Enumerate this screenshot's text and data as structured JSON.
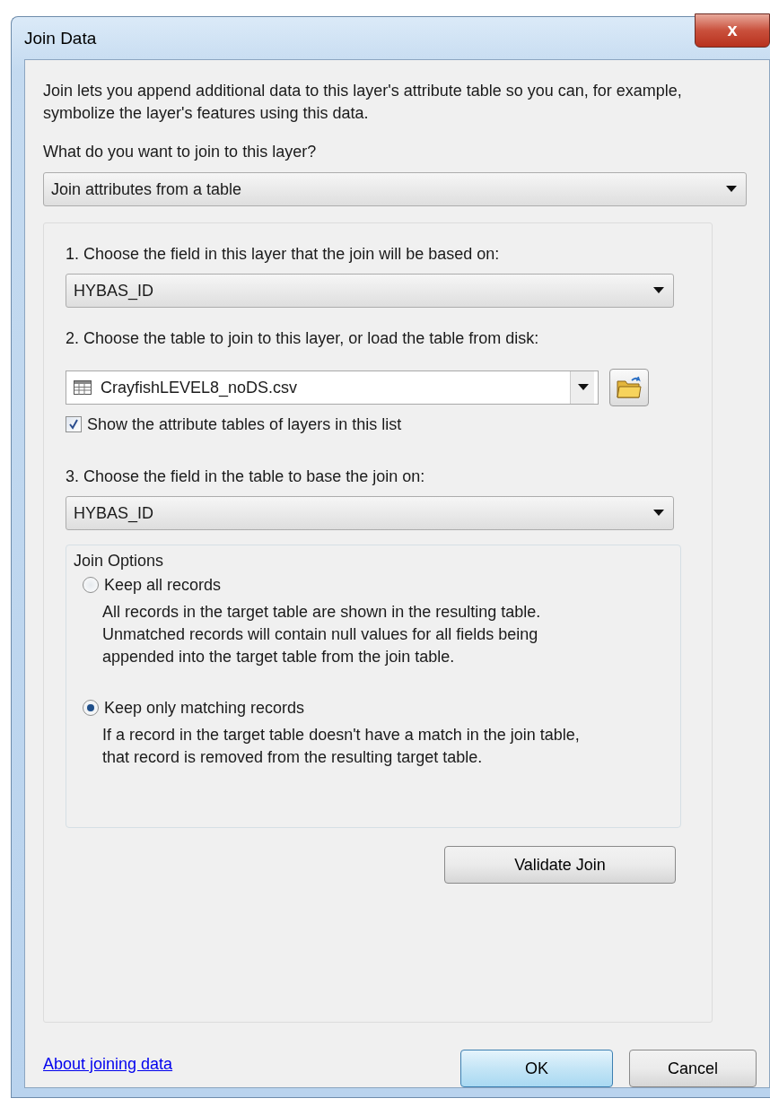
{
  "window": {
    "title": "Join Data",
    "close": "x"
  },
  "intro": "Join lets you append additional data to this layer's attribute table so you can, for example, symbolize the layer's features using this data.",
  "question": "What do you want to join to this layer?",
  "join_type": {
    "value": "Join attributes from a table"
  },
  "steps": [
    {
      "kind": "combo",
      "label": "1.  Choose the field in this layer that the join will be based on:",
      "value": "HYBAS_ID"
    },
    {
      "kind": "table",
      "label": "2.  Choose the table to join to this layer, or load the table from disk:",
      "value": "CrayfishLEVEL8_noDS.csv",
      "checkbox": {
        "label": "Show the attribute tables of layers in this list",
        "checked": true
      }
    },
    {
      "kind": "combo",
      "label": "3.  Choose the field in the table to base the join on:",
      "value": "HYBAS_ID"
    }
  ],
  "join_options": {
    "title": "Join Options",
    "options": [
      {
        "label": "Keep all records",
        "description": "All records in the target table are shown in the resulting table. Unmatched records will contain null values for all fields being appended into the target table from the join table.",
        "selected": false
      },
      {
        "label": "Keep only matching records",
        "description": "If a record in the target table doesn't have a match in the join table, that record is removed from the resulting target table.",
        "selected": true
      }
    ]
  },
  "validate_button": "Validate Join",
  "help_link": "About joining data",
  "buttons": [
    {
      "label": "OK",
      "kind": "default"
    },
    {
      "label": "Cancel",
      "kind": "normal"
    }
  ]
}
